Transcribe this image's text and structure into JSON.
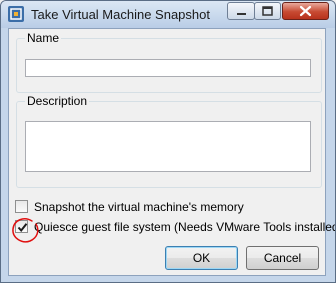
{
  "window": {
    "title": "Take Virtual Machine Snapshot",
    "icon": "vsphere-snapshot-icon"
  },
  "titlebar_buttons": [
    "minimize",
    "maximize",
    "close"
  ],
  "name_group": {
    "label": "Name",
    "value": "",
    "placeholder": ""
  },
  "description_group": {
    "label": "Description",
    "value": "",
    "placeholder": ""
  },
  "options": [
    {
      "label": "Snapshot the virtual machine's memory",
      "checked": false
    },
    {
      "label": "Quiesce guest file system (Needs VMware Tools installed)",
      "checked": true
    }
  ],
  "annotation": {
    "shape": "red circle around quiesce checkbox",
    "color": "#e01010"
  },
  "buttons": {
    "ok_label": "OK",
    "cancel_label": "Cancel"
  },
  "colors": {
    "title_bar": "#c5d6ea",
    "close_button": "#c74a32",
    "default_button_border": "#3c7fb1"
  }
}
